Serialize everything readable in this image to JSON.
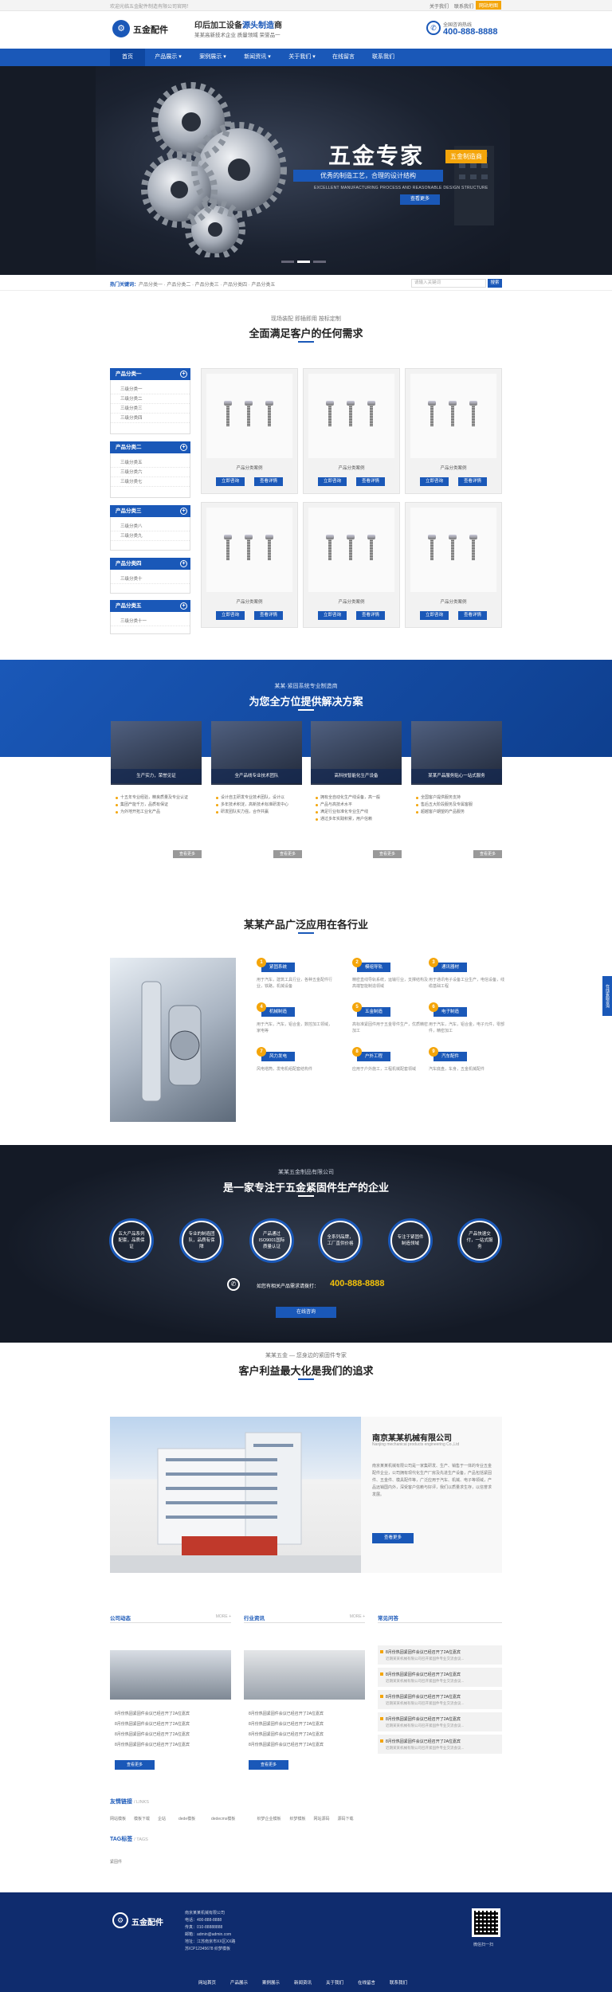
{
  "topbar": {
    "welcome": "欢迎光临五金配件制造有限公司官网！",
    "links": [
      "关于我们",
      "联系我们",
      "网站地图"
    ]
  },
  "header": {
    "logo_text": "五金配件",
    "logo_icon": "gear-logo-icon",
    "slogan_prefix": "印后加工设备",
    "slogan_highlight": "源头制造",
    "slogan_suffix": "商",
    "slogan_sub": "某某高新技术企业 质量领域 荣誉品一",
    "hotline_label": "全国咨询热线",
    "hotline_number": "400-888-8888"
  },
  "nav": {
    "items": [
      "首页",
      "产品展示 ▾",
      "案例展示 ▾",
      "新闻资讯 ▾",
      "关于我们 ▾",
      "在线留言",
      "联系我们"
    ]
  },
  "banner": {
    "title": "五金专家",
    "tag": "五金制造商",
    "bar": "优秀的制造工艺，合理的设计结构",
    "sub": "EXCELLENT MANUFACTURING PROCESS AND REASONABLE DESIGN STRUCTURE",
    "button": "查看更多"
  },
  "crumb": {
    "label": "热门关键词：",
    "path": "产品分类一 · 产品分类二 · 产品分类三 · 产品分类四 · 产品分类五",
    "search_placeholder": "请输入关键词",
    "search_button": "搜索"
  },
  "products_section": {
    "kicker": "现场装配 即插即用 按标定制",
    "title": "全面满足客户的任何需求",
    "sidebar": [
      {
        "title": "产品分类一",
        "items": [
          "三级分类一",
          "三级分类二",
          "三级分类三",
          "三级分类四"
        ]
      },
      {
        "title": "产品分类二",
        "items": [
          "三级分类五",
          "三级分类六",
          "三级分类七"
        ]
      },
      {
        "title": "产品分类三",
        "items": [
          "三级分类八",
          "三级分类九"
        ]
      },
      {
        "title": "产品分类四",
        "items": [
          "三级分类十"
        ]
      },
      {
        "title": "产品分类五",
        "items": [
          "三级分类十一"
        ]
      }
    ],
    "cards": [
      {
        "name": "产品分类案例",
        "btn1": "立即咨询",
        "btn2": "查看详情"
      },
      {
        "name": "产品分类案例",
        "btn1": "立即咨询",
        "btn2": "查看详情"
      },
      {
        "name": "产品分类案例",
        "btn1": "立即咨询",
        "btn2": "查看详情"
      },
      {
        "name": "产品分类案例",
        "btn1": "立即咨询",
        "btn2": "查看详情"
      },
      {
        "name": "产品分类案例",
        "btn1": "立即咨询",
        "btn2": "查看详情"
      },
      {
        "name": "产品分类案例",
        "btn1": "立即咨询",
        "btn2": "查看详情"
      }
    ]
  },
  "solutions_section": {
    "kicker": "某某·紧固系统专业制造商",
    "title": "为您全方位提供解决方案",
    "cards": [
      {
        "caption": "生产实力，荣誉见证",
        "points": [
          "十五年专业经验，精良质量及专业认证",
          "集团产能千万，品质有保证",
          "为外地开拓工业化产品"
        ],
        "more": "查看更多"
      },
      {
        "caption": "全产品线专业技术团队",
        "points": [
          "设计自主研发专业技术团队，设计以",
          "多年技术积淀，高新技术标准研发中心",
          "研发团队实力强，合作共赢"
        ],
        "more": "查看更多"
      },
      {
        "caption": "高科技智能化生产设备",
        "points": [
          "拥有全自动化生产线设备，高一般",
          "产品与高技术水平",
          "满足行业标准化专业生产线",
          "通过多年实践积累，用户信赖"
        ],
        "more": "查看更多"
      },
      {
        "caption": "某某产品服务贴心一站式服务",
        "points": [
          "全国客户提供服务支持",
          "售后五大阶段服务及专属客服",
          "超越客户期望的产品服务"
        ],
        "more": "查看更多"
      }
    ]
  },
  "applications_section": {
    "title": "某某产品广泛应用在各行业",
    "cells": [
      {
        "num": "1",
        "tag": "紧固系统",
        "desc": "用于汽车，建筑工具行业，各种五金配件行业，铁路，机械设备"
      },
      {
        "num": "2",
        "tag": "模组导轨",
        "desc": "精密直线导轨系统，运输行业，支撑结构及高端智能制造领域"
      },
      {
        "num": "3",
        "tag": "通讯器材",
        "desc": "用于通讯电子设备工业生产，电信设备，线缆基础工程"
      },
      {
        "num": "4",
        "tag": "机械制造",
        "desc": "用于汽车，汽车，铝合金，数控加工领域，家电等"
      },
      {
        "num": "5",
        "tag": "五金制造",
        "desc": "高标准紧固件用于五金零件生产，优质精密加工"
      },
      {
        "num": "6",
        "tag": "电子制造",
        "desc": "用于汽车，汽车，铝合金，电子元件，零部件，精密加工"
      },
      {
        "num": "7",
        "tag": "风力发电",
        "desc": "风电塔筒，发电机组配套结构件"
      },
      {
        "num": "8",
        "tag": "户外工程",
        "desc": "应用于户外施工，工程机械配套领域"
      },
      {
        "num": "9",
        "tag": "汽车配件",
        "desc": "汽车底盘，车身，五金机械配件"
      }
    ]
  },
  "enterprise_section": {
    "kicker": "某某五金制品有限公司",
    "title": "是一家专注于五金紧固件生产的企业",
    "circles": [
      "五大产品系列配套，品质保证",
      "专业的制造团队，品质有保障",
      "产品通过ISO9001国际质量认证",
      "全系列品牌，工厂直供价格",
      "专注于紧固件制造领域",
      "产品快速交付，一站式服务"
    ],
    "phone_text": "如您有相关产品需求请拨打：",
    "phone_number": "400-888-8888",
    "button": "在线咨询"
  },
  "about_section": {
    "kicker": "某某五金 — 您身边的紧固件专家",
    "title": "客户利益最大化是我们的追求",
    "company": "南京某某机械有限公司",
    "company_en": "Nanjing mechanical products engineering Co.,Ltd",
    "desc": "南京某某机械有限公司是一家集研发、生产、销售于一体的专业五金配件企业，公司拥有现代化生产厂房及先进生产设备，产品包括紧固件、五金件、模具配件等，广泛应用于汽车、机械、电子等领域，产品远销国内外，深受客户信赖与好评，我们以质量求生存，以信誉求发展。",
    "button": "查看更多"
  },
  "news_section": {
    "col1": {
      "title": "公司动态",
      "more": "MORE +",
      "items": [
        "8月份热固紧固件会议已经召开了2A位嘉宾",
        "8月份热固紧固件会议已经召开了2A位嘉宾",
        "8月份热固紧固件会议已经召开了2A位嘉宾",
        "8月份热固紧固件会议已经召开了2A位嘉宾"
      ],
      "button": "查看更多"
    },
    "col2": {
      "title": "行业资讯",
      "more": "MORE +",
      "items": [
        "8月份热固紧固件会议已经召开了2A位嘉宾",
        "8月份热固紧固件会议已经召开了2A位嘉宾",
        "8月份热固紧固件会议已经召开了2A位嘉宾",
        "8月份热固紧固件会议已经召开了2A位嘉宾"
      ],
      "button": "查看更多"
    },
    "faq": {
      "title": "常见问答",
      "items": [
        {
          "q": "8月份热固紧固件会议已经召开了2A位嘉宾",
          "a": "近期某某机械有限公司召开紧固件专业交流会议..."
        },
        {
          "q": "8月份热固紧固件会议已经召开了2A位嘉宾",
          "a": "近期某某机械有限公司召开紧固件专业交流会议..."
        },
        {
          "q": "8月份热固紧固件会议已经召开了2A位嘉宾",
          "a": "近期某某机械有限公司召开紧固件专业交流会议..."
        },
        {
          "q": "8月份热固紧固件会议已经召开了2A位嘉宾",
          "a": "近期某某机械有限公司召开紧固件专业交流会议..."
        },
        {
          "q": "8月份热固紧固件会议已经召开了2A位嘉宾",
          "a": "近期某某机械有限公司召开紧固件专业交流会议..."
        }
      ]
    }
  },
  "links_section": {
    "title": "友情链接",
    "title_en": "/ LINKS",
    "items": [
      "网站模板",
      "模板下载",
      "企站",
      "dede模板",
      "dedecms模板",
      "织梦企业模板",
      "织梦模板",
      "网站源码",
      "源码下载"
    ]
  },
  "tags_section": {
    "title": "TAG标签",
    "title_en": "/ TAGS",
    "items": [
      "紧固件"
    ]
  },
  "footer": {
    "logo_text": "五金配件",
    "lines": [
      "南京某某机械有限公司",
      "电话：400-888-8888",
      "传真：010-88888888",
      "邮箱：admin@admin.com",
      "地址：江苏南京市XX区XX路",
      "苏ICP12345678 织梦模板"
    ],
    "qr_label": "微信扫一扫",
    "nav": [
      "网站首页",
      "产品展示",
      "案例展示",
      "新闻资讯",
      "关于我们",
      "在线留言",
      "联系我们"
    ]
  },
  "side_float": "在线客服咨询",
  "colors": {
    "primary": "#1a58b8",
    "accent": "#f4a50a",
    "footer": "#0f2c6e"
  }
}
